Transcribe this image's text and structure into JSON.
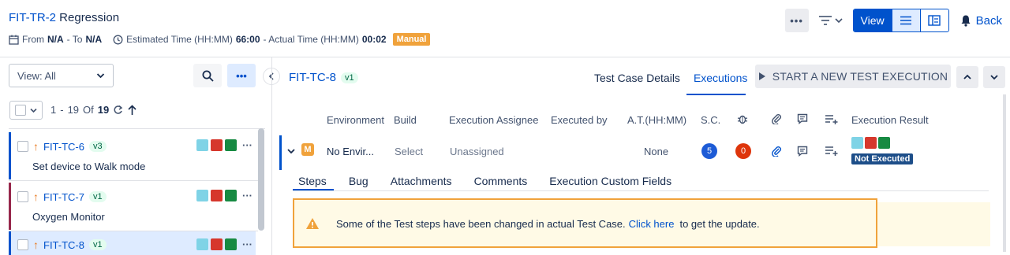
{
  "header": {
    "id": "FIT-TR-2",
    "title": "Regression",
    "from_label": "From",
    "from_value": "N/A",
    "to_label": "- To",
    "to_value": "N/A",
    "est_label": "Estimated Time (HH:MM)",
    "est_value": "66:00",
    "act_label": "- Actual Time (HH:MM)",
    "act_value": "00:02",
    "type_badge": "Manual",
    "more_label": "•••",
    "view_label": "View",
    "back_label": "Back"
  },
  "left": {
    "view_select": "View: All",
    "more_label": "•••",
    "pager": {
      "start": "1",
      "sep": "-",
      "end": "19",
      "of": "Of",
      "total": "19"
    },
    "items": [
      {
        "id": "FIT-TC-6",
        "version": "v3",
        "name": "Set device to Walk mode",
        "bar": "#0052cc"
      },
      {
        "id": "FIT-TC-7",
        "version": "v1",
        "name": "Oxygen Monitor",
        "bar": "#97274b"
      },
      {
        "id": "FIT-TC-8",
        "version": "v1",
        "name": "",
        "bar": "#0052cc"
      }
    ],
    "status_colors": [
      "#7fd3e6",
      "#d6372c",
      "#178a42"
    ]
  },
  "main": {
    "tc_id": "FIT-TC-8",
    "tc_version": "v1",
    "tabs": [
      "Test Case Details",
      "Executions"
    ],
    "start_button": "START A NEW TEST EXECUTION",
    "columns": {
      "environment": "Environment",
      "build": "Build",
      "assignee": "Execution Assignee",
      "executed_by": "Executed by",
      "at": "A.T.(HH:MM)",
      "sc": "S.C.",
      "result": "Execution Result"
    },
    "execution": {
      "type_badge": "M",
      "environment": "No Envir...",
      "build": "Select",
      "assignee": "Unassigned",
      "at": "None",
      "sc_count": "5",
      "bug_count": "0",
      "result": "Not Executed"
    },
    "subtabs": [
      "Steps",
      "Bug",
      "Attachments",
      "Comments",
      "Execution Custom Fields"
    ],
    "warning": {
      "text": "Some of the Test steps have been changed in actual Test Case.",
      "link": "Click here",
      "after": "to get the update."
    }
  },
  "colors": {
    "accent": "#0052cc",
    "manual": "#f0a23b",
    "sc_blue": "#1d5bd6",
    "bug_red": "#de350b",
    "result_badge": "#1d4e89"
  }
}
